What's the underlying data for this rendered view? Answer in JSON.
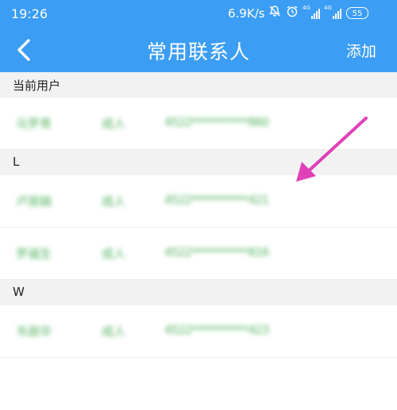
{
  "status_bar": {
    "time": "19:26",
    "network_speed": "6.9K/s",
    "mute_icon": "bell-off-icon",
    "alarm_icon": "alarm-icon",
    "signal_label": "4G",
    "battery": "55"
  },
  "header": {
    "back_icon": "chevron-left-icon",
    "title": "常用联系人",
    "add_label": "添加"
  },
  "sections": [
    {
      "label": "当前用户",
      "contacts": [
        {
          "name": "马罗青",
          "type": "成人",
          "id": "4522***********860"
        }
      ]
    },
    {
      "label": "L",
      "contacts": [
        {
          "name": "卢丽娟",
          "type": "成人",
          "id": "4522***********421"
        },
        {
          "name": "罗福生",
          "type": "成人",
          "id": "4522***********816"
        }
      ]
    },
    {
      "label": "W",
      "contacts": [
        {
          "name": "韦丽华",
          "type": "成人",
          "id": "4522***********423"
        }
      ]
    }
  ],
  "annotation": {
    "icon": "arrow-icon",
    "color": "#e040b8"
  },
  "colors": {
    "header": "#3b9df4",
    "blurred_text": "#55b561",
    "section_bg": "#f2f2f2"
  }
}
